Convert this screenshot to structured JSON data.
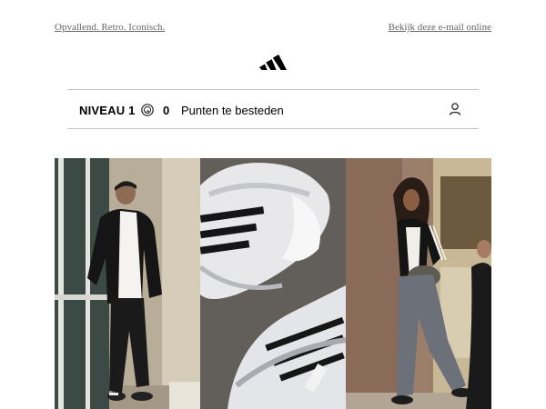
{
  "preheader": {
    "tagline": "Opvallend. Retro. Iconisch.",
    "view_online": "Bekijk deze e-mail online"
  },
  "brand": {
    "logo": "adidas-logo"
  },
  "loyalty": {
    "level": "NIVEAU 1",
    "points": "0",
    "points_label": "Punten te besteden",
    "coin_icon": "coin-icon",
    "account_icon": "user-icon"
  },
  "hero": {
    "panels": [
      "man-in-black-tracksuit-photo",
      "white-sneakers-closeup-photo",
      "woman-in-track-jacket-photo"
    ]
  }
}
